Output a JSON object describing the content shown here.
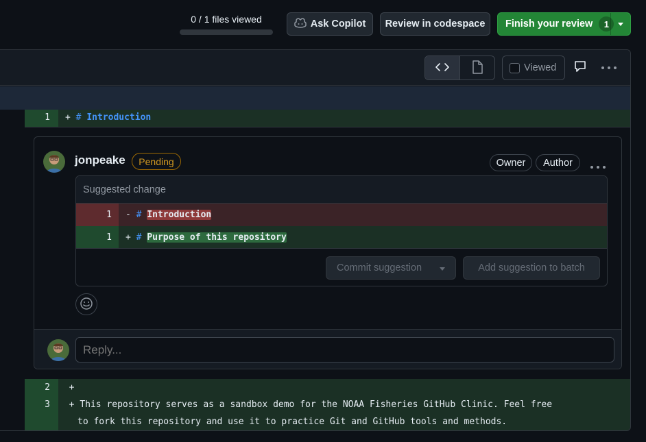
{
  "toolbar": {
    "files_viewed": "0 / 1 files viewed",
    "ask_copilot": "Ask Copilot",
    "review_codespace": "Review in codespace",
    "finish_review": "Finish your review",
    "finish_count": "1"
  },
  "file_header": {
    "viewed_label": "Viewed",
    "icons": [
      "code-icon",
      "file-icon",
      "comment-icon",
      "kebab-icon"
    ]
  },
  "diff": {
    "line1": {
      "num": "1",
      "sign": "+",
      "hash": "#",
      "text": "Introduction"
    },
    "line2": {
      "num": "2",
      "sign": "+"
    },
    "line3": {
      "num": "3",
      "sign": "+",
      "text": "This repository serves as a sandbox demo for the NOAA Fisheries GitHub Clinic. Feel free",
      "text_cont": "to fork this repository and use it to practice Git and GitHub tools and methods."
    }
  },
  "comment": {
    "author": "jonpeake",
    "status": "Pending",
    "badges": [
      "Owner",
      "Author"
    ],
    "suggestion": {
      "header": "Suggested change",
      "removed": {
        "num": "1",
        "sign": "-",
        "hash": "#",
        "text": "Introduction"
      },
      "added": {
        "num": "1",
        "sign": "+",
        "hash": "#",
        "text": "Purpose of this repository"
      },
      "commit_label": "Commit suggestion",
      "batch_label": "Add suggestion to batch"
    }
  },
  "reply": {
    "placeholder": "Reply..."
  },
  "colors": {
    "accent_green": "#238636",
    "pending": "#d29922",
    "link_blue": "#4493f8"
  }
}
